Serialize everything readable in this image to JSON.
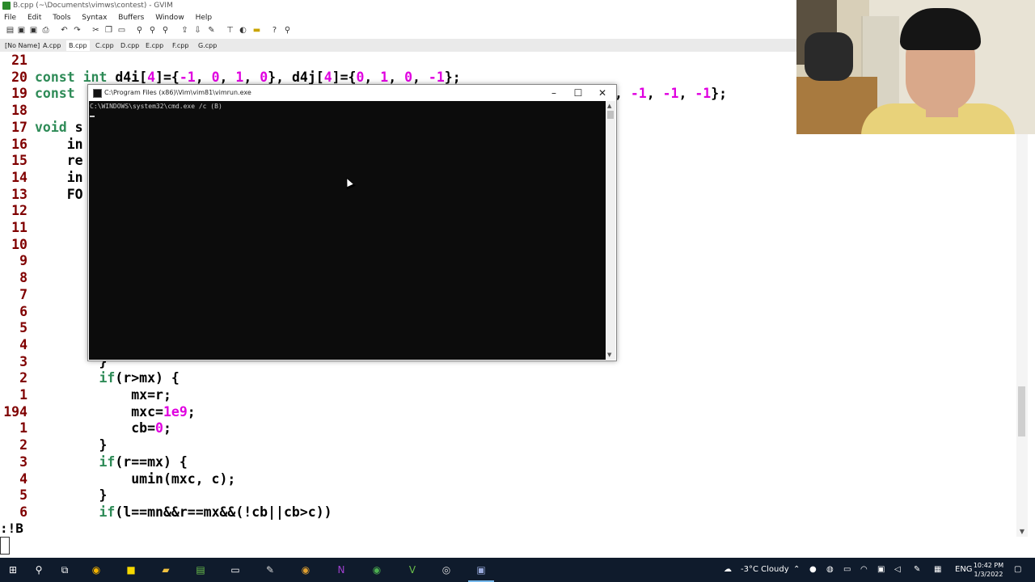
{
  "gvim": {
    "title": "B.cpp (~\\Documents\\vimws\\contest) - GVIM",
    "menu": [
      "File",
      "Edit",
      "Tools",
      "Syntax",
      "Buffers",
      "Window",
      "Help"
    ],
    "tabs": [
      "[No Name]",
      "A.cpp",
      "B.cpp",
      "C.cpp",
      "D.cpp",
      "E.cpp",
      "F.cpp",
      "G.cpp"
    ],
    "active_tab": "B.cpp",
    "toolbar_icons": [
      "open-icon",
      "save-icon",
      "save-all-icon",
      "print-icon",
      "undo-icon",
      "redo-icon",
      "cut-icon",
      "copy-icon",
      "paste-icon",
      "find-replace-icon",
      "find-next-icon",
      "find-prev-icon",
      "load-session-icon",
      "save-session-icon",
      "run-script-icon",
      "make-icon",
      "shell-icon",
      "make-tags-icon",
      "help-icon",
      "find-help-icon"
    ],
    "code_lines": [
      {
        "ln": "21",
        "text": ""
      },
      {
        "ln": "20",
        "text": "const int d4i[4]={-1, 0, 1, 0}, d4j[4]={0, 1, 0, -1};"
      },
      {
        "ln": "19",
        "text": "const"
      },
      {
        "ln": "18",
        "text": ""
      },
      {
        "ln": "17",
        "text": "void s"
      },
      {
        "ln": "16",
        "text": "    in"
      },
      {
        "ln": "15",
        "text": "    re"
      },
      {
        "ln": "14",
        "text": "    in"
      },
      {
        "ln": "13",
        "text": "    FO"
      },
      {
        "ln": "12",
        "text": ""
      },
      {
        "ln": "11",
        "text": ""
      },
      {
        "ln": "10",
        "text": ""
      },
      {
        "ln": "9",
        "text": ""
      },
      {
        "ln": "8",
        "text": ""
      },
      {
        "ln": "7",
        "text": ""
      },
      {
        "ln": "6",
        "text": ""
      },
      {
        "ln": "5",
        "text": ""
      },
      {
        "ln": "4",
        "text": ""
      },
      {
        "ln": "3",
        "text": "        }"
      },
      {
        "ln": "2",
        "text": "        if(r>mx) {"
      },
      {
        "ln": "1",
        "text": "            mx=r;"
      },
      {
        "ln": "194",
        "text": "            mxc=1e9;"
      },
      {
        "ln": "1",
        "text": "            cb=0;"
      },
      {
        "ln": "2",
        "text": "        }"
      },
      {
        "ln": "3",
        "text": "        if(r==mx) {"
      },
      {
        "ln": "4",
        "text": "            umin(mxc, c);"
      },
      {
        "ln": "5",
        "text": "        }"
      },
      {
        "ln": "6",
        "text": "        if(l==mn&&r==mx&&(!cb||cb>c))"
      }
    ],
    "line19_tail": ", -1, -1, -1};",
    "cmdline": ":!B"
  },
  "cmd_window": {
    "title": "C:\\Program Files (x86)\\Vim\\vim81\\vimrun.exe",
    "output": "C:\\WINDOWS\\system32\\cmd.exe /c (B)"
  },
  "taskbar": {
    "apps": [
      "start-icon",
      "search-icon",
      "task-view-icon",
      "chrome-icon",
      "sticky-notes-icon",
      "file-explorer-icon",
      "notepad-icon",
      "terminal-icon",
      "paint-icon",
      "chrome-canary-icon",
      "onenote-icon",
      "chrome-dev-icon",
      "vim-icon",
      "obs-icon",
      "gvim-icon"
    ],
    "weather": "-3°C  Cloudy",
    "lang": "ENG",
    "time": "10:42 PM",
    "date": "1/3/2022"
  }
}
